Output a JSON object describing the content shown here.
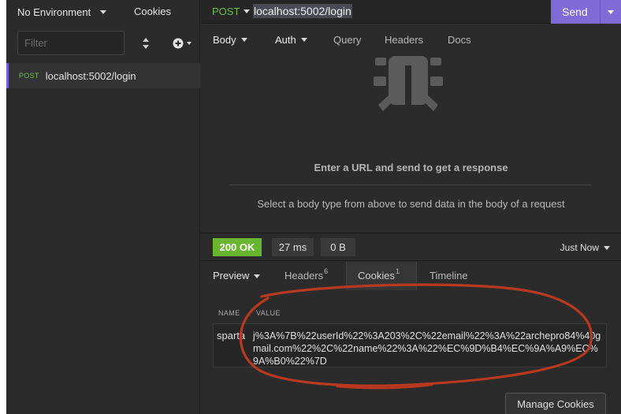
{
  "sidebar": {
    "environment_label": "No Environment",
    "cookies_label": "Cookies",
    "filter_placeholder": "Filter",
    "request": {
      "method": "POST",
      "url": "localhost:5002/login"
    }
  },
  "urlbar": {
    "method": "POST",
    "url": "localhost:5002/login",
    "send_label": "Send"
  },
  "request_tabs": {
    "body": "Body",
    "auth": "Auth",
    "query": "Query",
    "headers": "Headers",
    "docs": "Docs"
  },
  "request_body": {
    "empty_message": "Enter a URL and send to get a response",
    "hint": "Select a body type from above to send data in the body of a request"
  },
  "response": {
    "status": "200 OK",
    "time": "27 ms",
    "size": "0 B",
    "timestamp": "Just Now",
    "tabs": {
      "preview": "Preview",
      "headers": "Headers",
      "headers_count": "6",
      "cookies": "Cookies",
      "cookies_count": "1",
      "timeline": "Timeline"
    }
  },
  "cookies_table": {
    "col_name": "NAME",
    "col_value": "VALUE",
    "row": {
      "name": "sparta",
      "value": "j%3A%7B%22userId%22%3A203%2C%22email%22%3A%22archepro84%40gmail.com%22%2C%22name%22%3A%22%EC%9D%B4%EC%9A%A9%EC%9A%B0%22%7D"
    },
    "manage_button": "Manage Cookies"
  },
  "colors": {
    "accent": "#7e6bd6",
    "success": "#6ab530",
    "method_post": "#6cc04a",
    "annotation": "#b8391f"
  }
}
